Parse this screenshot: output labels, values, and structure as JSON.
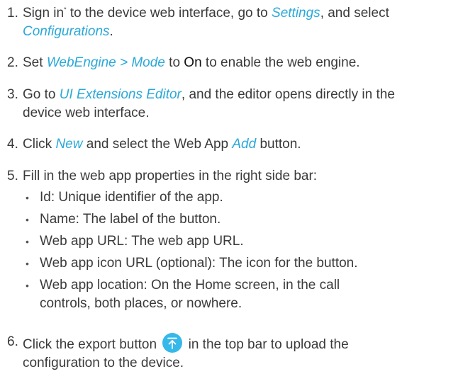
{
  "steps": [
    {
      "number": "1.",
      "p1": "Sign in",
      "sup": "*",
      "p2": " to the device web interface, go to ",
      "link1": "Settings",
      "p3": ", and select",
      "link2": "Configurations",
      "p4": "."
    },
    {
      "number": "2.",
      "p1": "Set ",
      "link1": "WebEngine > Mode",
      "p2": " to ",
      "strong": "On",
      "p3": " to enable the web engine."
    },
    {
      "number": "3.",
      "p1": "Go to ",
      "link1": "UI Extensions Editor",
      "p2": ", and the editor opens directly in the",
      "line2": "device web interface."
    },
    {
      "number": "4.",
      "p1": "Click ",
      "link1": "New",
      "p2": " and select the Web App ",
      "link2": "Add",
      "p3": " button."
    },
    {
      "number": "5.",
      "p1": "Fill in the web app properties in the right side bar:"
    },
    {
      "number": "6.",
      "p1": "Click the export button ",
      "p2": " in the top bar to upload the",
      "line2": "configuration to the device."
    }
  ],
  "bullets": [
    {
      "symbol": "•",
      "line1": "Id: Unique identifier of the app."
    },
    {
      "symbol": "•",
      "line1": "Name: The label of the button."
    },
    {
      "symbol": "•",
      "line1": "Web app URL: The web app URL."
    },
    {
      "symbol": "•",
      "line1": "Web app icon URL (optional): The icon for the button."
    },
    {
      "symbol": "•",
      "line1": "Web app location: On the Home screen, in the call",
      "line2": "controls, both places, or nowhere."
    }
  ],
  "colors": {
    "link": "#2aa8d8",
    "text": "#3a3a3a",
    "export_icon_bg": "#36b8ea"
  },
  "icons": {
    "export": "export-upload-icon"
  }
}
